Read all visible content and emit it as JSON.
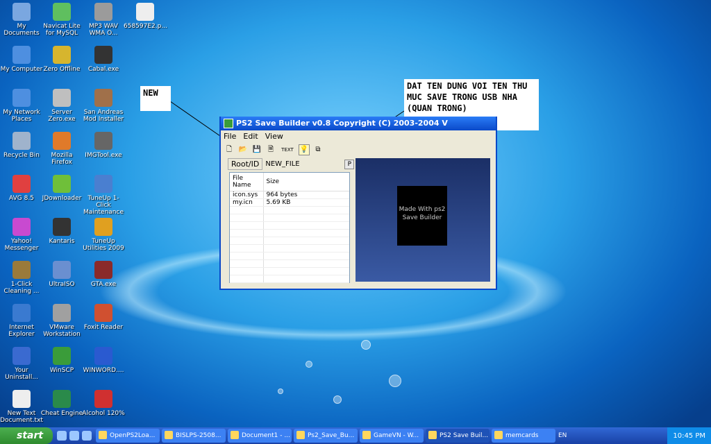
{
  "desktop": {
    "icons": [
      {
        "label": "My Documents"
      },
      {
        "label": "Navicat Lite for MySQL"
      },
      {
        "label": "MP3 WAV WMA O..."
      },
      {
        "label": "658597E2.p..."
      },
      {
        "label": "My Computer"
      },
      {
        "label": "Zero Offline"
      },
      {
        "label": "Cabal.exe"
      },
      {
        "label": "My Network Places"
      },
      {
        "label": "Server Zero.exe"
      },
      {
        "label": "San Andreas Mod Installer"
      },
      {
        "label": "Recycle Bin"
      },
      {
        "label": "Mozilla Firefox"
      },
      {
        "label": "IMGTool.exe"
      },
      {
        "label": "AVG 8.5"
      },
      {
        "label": "JDownloader"
      },
      {
        "label": "TuneUp 1-Click Maintenance"
      },
      {
        "label": "Yahoo! Messenger"
      },
      {
        "label": "Kantaris"
      },
      {
        "label": "TuneUp Utilities 2009"
      },
      {
        "label": "1-Click Cleaning ..."
      },
      {
        "label": "UltraISO"
      },
      {
        "label": "GTA.exe"
      },
      {
        "label": "Internet Explorer"
      },
      {
        "label": "VMware Workstation"
      },
      {
        "label": "Foxit Reader"
      },
      {
        "label": "Your Uninstall..."
      },
      {
        "label": "WinSCP"
      },
      {
        "label": "WINWORD...."
      },
      {
        "label": "New Text Document.txt"
      },
      {
        "label": "Cheat Engine"
      },
      {
        "label": "Alcohol 120%"
      }
    ]
  },
  "notes": {
    "new": "NEW",
    "hint": "DAT TEN DUNG VOI TEN THU MUC SAVE TRONG USB NHA (QUAN TRONG)"
  },
  "window": {
    "title": "PS2 Save Builder v0.8 Copyright (C) 2003-2004 V",
    "menu": [
      "File",
      "Edit",
      "View"
    ],
    "toolbar_text": "TEXT",
    "root_label": "Root/ID",
    "root_value": "NEW_FILE",
    "p_button": "P",
    "columns": [
      "File Name",
      "Size"
    ],
    "files": [
      {
        "name": "icon.sys",
        "size": "964 bytes"
      },
      {
        "name": "my.icn",
        "size": "5.69 KB"
      }
    ],
    "preview_text": "Made With ps2 Save Builder"
  },
  "taskbar": {
    "start": "start",
    "tasks": [
      "OpenPS2Loa...",
      "BISLPS-2508...",
      "Document1 - ...",
      "Ps2_Save_Bu...",
      "GameVN - W...",
      "PS2 Save Buil...",
      "memcards"
    ],
    "lang": "EN",
    "time": "10:45 PM"
  }
}
